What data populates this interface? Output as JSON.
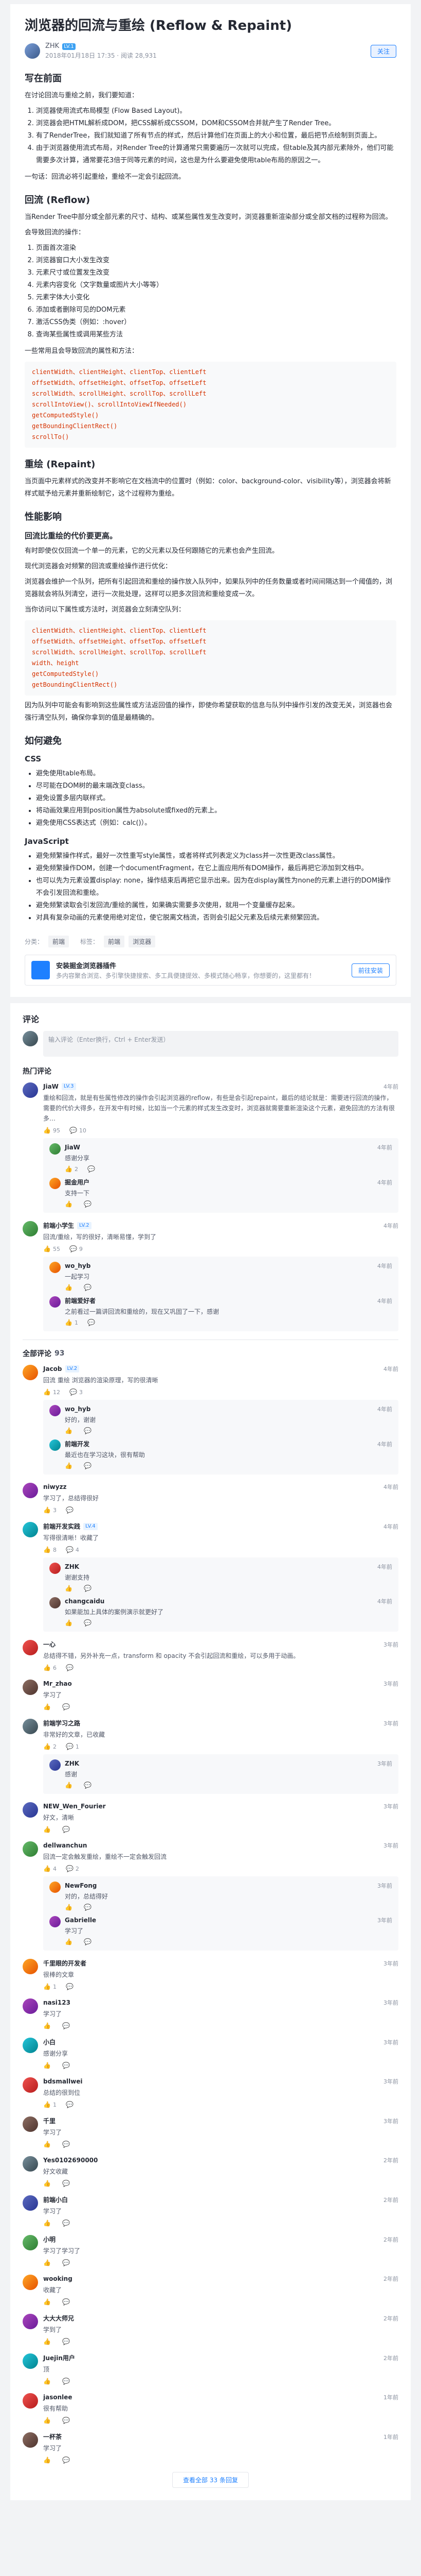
{
  "article": {
    "title": "浏览器的回流与重绘 (Reflow & Repaint)",
    "author": "ZHK",
    "level": "LV.1",
    "meta": "2018年01月18日 17:35 · 阅读 28,931",
    "follow": "关注",
    "s1": "写在前面",
    "s1_p": "在讨论回流与重绘之前，我们要知道：",
    "s1_items": [
      "浏览器使用流式布局模型 (Flow Based Layout)。",
      "浏览器会把HTML解析成DOM，把CSS解析成CSSOM，DOM和CSSOM合并就产生了Render Tree。",
      "有了RenderTree，我们就知道了所有节点的样式，然后计算他们在页面上的大小和位置，最后把节点绘制到页面上。",
      "由于浏览器使用流式布局，对Render Tree的计算通常只需要遍历一次就可以完成，但table及其内部元素除外，他们可能需要多次计算，通常要花3倍于同等元素的时间，这也是为什么要避免使用table布局的原因之一。"
    ],
    "s1_note": "一句话：回流必将引起重绘，重绘不一定会引起回流。",
    "s2": "回流 (Reflow)",
    "s2_p": "当Render Tree中部分或全部元素的尺寸、结构、或某些属性发生改变时，浏览器重新渲染部分或全部文档的过程称为回流。",
    "s2_p2": "会导致回流的操作：",
    "s2_items": [
      "页面首次渲染",
      "浏览器窗口大小发生改变",
      "元素尺寸或位置发生改变",
      "元素内容变化（文字数量或图片大小等等）",
      "元素字体大小变化",
      "添加或者删除可见的DOM元素",
      "激活CSS伪类（例如：:hover）",
      "查询某些属性或调用某些方法"
    ],
    "s2_p3": "一些常用且会导致回流的属性和方法：",
    "s2_code": [
      "clientWidth、clientHeight、clientTop、clientLeft",
      "offsetWidth、offsetHeight、offsetTop、offsetLeft",
      "scrollWidth、scrollHeight、scrollTop、scrollLeft",
      "scrollIntoView()、scrollIntoViewIfNeeded()",
      "getComputedStyle()",
      "getBoundingClientRect()",
      "scrollTo()"
    ],
    "s3": "重绘 (Repaint)",
    "s3_p": "当页面中元素样式的改变并不影响它在文档流中的位置时（例如：color、background-color、visibility等），浏览器会将新样式赋予给元素并重新绘制它，这个过程称为重绘。",
    "s4": "性能影响",
    "s4_sub": "回流比重绘的代价要更高。",
    "s4_p1": "有时即使仅仅回流一个单一的元素，它的父元素以及任何跟随它的元素也会产生回流。",
    "s4_p2": "现代浏览器会对频繁的回流或重绘操作进行优化：",
    "s4_p3": "浏览器会维护一个队列，把所有引起回流和重绘的操作放入队列中，如果队列中的任务数量或者时间间隔达到一个阈值的，浏览器就会将队列清空，进行一次批处理，这样可以把多次回流和重绘变成一次。",
    "s4_p4": "当你访问以下属性或方法时，浏览器会立刻清空队列：",
    "s4_code": [
      "clientWidth、clientHeight、clientTop、clientLeft",
      "offsetWidth、offsetHeight、offsetTop、offsetLeft",
      "scrollWidth、scrollHeight、scrollTop、scrollLeft",
      "width、height",
      "getComputedStyle()",
      "getBoundingClientRect()"
    ],
    "s4_p5": "因为队列中可能会有影响到这些属性或方法返回值的操作，即使你希望获取的信息与队列中操作引发的改变无关，浏览器也会强行清空队列，确保你拿到的值是最精确的。",
    "s5": "如何避免",
    "s5_css": "CSS",
    "s5_css_items": [
      "避免使用table布局。",
      "尽可能在DOM树的最末端改变class。",
      "避免设置多层内联样式。",
      "将动画效果应用到position属性为absolute或fixed的元素上。",
      "避免使用CSS表达式（例如：calc()）。"
    ],
    "s5_js": "JavaScript",
    "s5_js_items": [
      "避免频繁操作样式，最好一次性重写style属性，或者将样式列表定义为class并一次性更改class属性。",
      "避免频繁操作DOM，创建一个documentFragment，在它上面应用所有DOM操作，最后再把它添加到文档中。",
      "也可以先为元素设置display: none，操作结束后再把它显示出来。因为在display属性为none的元素上进行的DOM操作不会引发回流和重绘。",
      "避免频繁读取会引发回流/重绘的属性，如果确实需要多次使用，就用一个变量缓存起来。",
      "对具有复杂动画的元素使用绝对定位，使它脱离文档流，否则会引起父元素及后续元素频繁回流。"
    ],
    "tags_label": "分类：",
    "category": "前端",
    "tags_label2": "标签：",
    "tags": [
      "前端",
      "浏览器"
    ],
    "column_title": "安装掘金浏览器插件",
    "column_desc": "多内容聚合浏览、多引擎快捷搜索、多工具便捷提效、多模式随心畅享，你想要的，这里都有！",
    "column_btn": "前往安装"
  },
  "comments": {
    "header": "评论",
    "input_placeholder": "输入评论（Enter换行，Ctrl + Enter发送）",
    "hot_label": "热门评论",
    "all_label": "全部评论",
    "all_count": "93",
    "more_label": "查看全部 33 条回复",
    "like_icon": "thumb-up-icon",
    "reply_icon": "comment-icon",
    "hot": [
      {
        "name": "JiaW",
        "badge": "LV.3",
        "time": "4年前",
        "text": "重绘和回流，就是有些属性修改的操作会引起浏览器的reflow，有些是会引起repaint，最后的结论就是：需要进行回流的操作，需要的代价大得多，在开发中有时候，比如当一个元素的样式发生改变时，浏览器就需要重新渲染这个元素，避免回流的方法有很多…",
        "likes": "95",
        "replies": "10",
        "sub": [
          {
            "name": "JiaW",
            "time": "4年前",
            "text": "感谢分享",
            "likes": "2",
            "replies": ""
          },
          {
            "name": "掘金用户",
            "time": "4年前",
            "text": "支持一下",
            "likes": "",
            "replies": ""
          }
        ]
      },
      {
        "name": "前端小学生",
        "badge": "LV.2",
        "time": "4年前",
        "text": "回流/重绘，写的很好，清晰易懂，学到了",
        "likes": "55",
        "replies": "9",
        "sub": [
          {
            "name": "wo_hyb",
            "time": "4年前",
            "text": "一起学习",
            "likes": "",
            "replies": ""
          },
          {
            "name": "前端爱好者",
            "time": "4年前",
            "text": "之前看过一篇讲回流和重绘的，现在又巩固了一下，感谢",
            "likes": "1",
            "replies": ""
          }
        ]
      }
    ],
    "all": [
      {
        "name": "Jacob",
        "badge": "LV.2",
        "time": "4年前",
        "text": "回流 重绘 浏览器的渲染原理，写的很清晰",
        "likes": "12",
        "replies": "3",
        "sub": [
          {
            "name": "wo_hyb",
            "time": "4年前",
            "text": "好的，谢谢",
            "likes": "",
            "replies": ""
          },
          {
            "name": "前端开发",
            "time": "4年前",
            "text": "最近也在学习这块，很有帮助",
            "likes": "",
            "replies": ""
          }
        ]
      },
      {
        "name": "niwyzz",
        "badge": "",
        "time": "4年前",
        "text": "学习了，总结得很好",
        "likes": "3",
        "replies": "",
        "sub": []
      },
      {
        "name": "前端开发实践",
        "badge": "LV.4",
        "time": "4年前",
        "text": "写得很清晰！收藏了",
        "likes": "8",
        "replies": "4",
        "sub": [
          {
            "name": "ZHK",
            "time": "4年前",
            "text": "谢谢支持",
            "likes": "",
            "replies": ""
          },
          {
            "name": "changcaidu",
            "time": "4年前",
            "text": "如果能加上具体的案例演示就更好了",
            "likes": "",
            "replies": ""
          }
        ]
      },
      {
        "name": "一心",
        "badge": "",
        "time": "3年前",
        "text": "总结得不错，另外补充一点，transform 和 opacity 不会引起回流和重绘，可以多用于动画。",
        "likes": "6",
        "replies": "",
        "sub": []
      },
      {
        "name": "Mr_zhao",
        "badge": "",
        "time": "3年前",
        "text": "学习了",
        "likes": "",
        "replies": "",
        "sub": []
      },
      {
        "name": "前端学习之路",
        "badge": "",
        "time": "3年前",
        "text": "非常好的文章，已收藏",
        "likes": "2",
        "replies": "1",
        "sub": [
          {
            "name": "ZHK",
            "time": "3年前",
            "text": "感谢",
            "likes": "",
            "replies": ""
          }
        ]
      },
      {
        "name": "NEW_Wen_Fourier",
        "badge": "",
        "time": "3年前",
        "text": "好文，清晰",
        "likes": "",
        "replies": "",
        "sub": []
      },
      {
        "name": "dellwanchun",
        "badge": "",
        "time": "3年前",
        "text": "回流一定会触发重绘，重绘不一定会触发回流",
        "likes": "4",
        "replies": "2",
        "sub": [
          {
            "name": "NewFong",
            "time": "3年前",
            "text": "对的，总结得好",
            "likes": "",
            "replies": ""
          },
          {
            "name": "Gabrielle",
            "time": "3年前",
            "text": "学习了",
            "likes": "",
            "replies": ""
          }
        ]
      },
      {
        "name": "千里眼的开发者",
        "badge": "",
        "time": "3年前",
        "text": "很棒的文章",
        "likes": "1",
        "replies": "",
        "sub": []
      },
      {
        "name": "nasi123",
        "badge": "",
        "time": "3年前",
        "text": "学习了",
        "likes": "",
        "replies": "",
        "sub": []
      },
      {
        "name": "小白",
        "badge": "",
        "time": "3年前",
        "text": "感谢分享",
        "likes": "",
        "replies": "",
        "sub": []
      },
      {
        "name": "bdsmallwei",
        "badge": "",
        "time": "3年前",
        "text": "总结的很到位",
        "likes": "1",
        "replies": "",
        "sub": []
      },
      {
        "name": "千里",
        "badge": "",
        "time": "3年前",
        "text": "学习了",
        "likes": "",
        "replies": "",
        "sub": []
      },
      {
        "name": "Yes0102690000",
        "badge": "",
        "time": "2年前",
        "text": "好文收藏",
        "likes": "",
        "replies": "",
        "sub": []
      },
      {
        "name": "前端小白",
        "badge": "",
        "time": "2年前",
        "text": "学习了",
        "likes": "",
        "replies": "",
        "sub": []
      },
      {
        "name": "小明",
        "badge": "",
        "time": "2年前",
        "text": "学习了学习了",
        "likes": "",
        "replies": "",
        "sub": []
      },
      {
        "name": "wooking",
        "badge": "",
        "time": "2年前",
        "text": "收藏了",
        "likes": "",
        "replies": "",
        "sub": []
      },
      {
        "name": "大大大师兄",
        "badge": "",
        "time": "2年前",
        "text": "学到了",
        "likes": "",
        "replies": "",
        "sub": []
      },
      {
        "name": "Juejin用户",
        "badge": "",
        "time": "2年前",
        "text": "顶",
        "likes": "",
        "replies": "",
        "sub": []
      },
      {
        "name": "jasonlee",
        "badge": "",
        "time": "1年前",
        "text": "很有帮助",
        "likes": "",
        "replies": "",
        "sub": []
      },
      {
        "name": "一杯茶",
        "badge": "",
        "time": "1年前",
        "text": "学习了",
        "likes": "",
        "replies": "",
        "sub": []
      }
    ],
    "footer": "查看全部 33 条回复"
  }
}
